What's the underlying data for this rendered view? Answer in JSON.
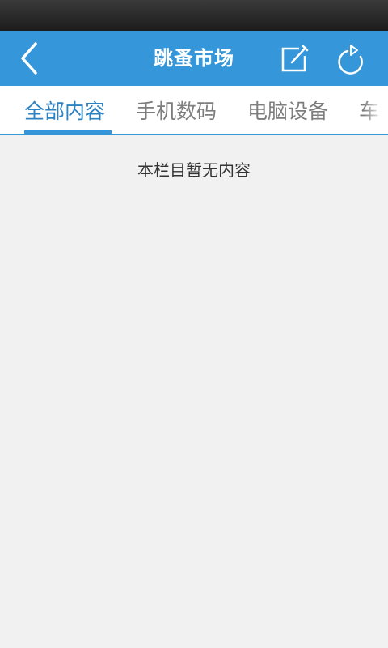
{
  "app_bar": {
    "title": "跳蚤市场",
    "back_icon": "chevron-left-icon",
    "edit_icon": "edit-compose-icon",
    "refresh_icon": "refresh-icon",
    "color": "#3597d9"
  },
  "tabs": [
    {
      "label": "全部内容",
      "active": true
    },
    {
      "label": "手机数码",
      "active": false
    },
    {
      "label": "电脑设备",
      "active": false
    },
    {
      "label": "车",
      "active": false
    }
  ],
  "content": {
    "empty_message": "本栏目暂无内容"
  },
  "colors": {
    "accent": "#3597d9",
    "active_tab_text": "#2c82c2",
    "inactive_tab_text": "#7d7d7d",
    "background": "#f1f1f1"
  }
}
